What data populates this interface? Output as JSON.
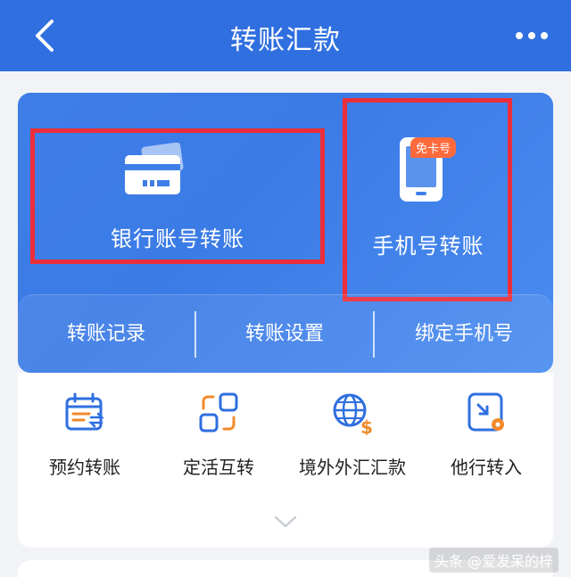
{
  "header": {
    "title": "转账汇款",
    "back_icon": "chevron-left-icon",
    "more_icon": "more-dots-icon"
  },
  "transfer_options": {
    "bank": {
      "label": "银行账号转账",
      "icon": "bank-card-icon"
    },
    "phone": {
      "label": "手机号转账",
      "badge": "免卡号",
      "icon": "mobile-phone-icon"
    }
  },
  "quick_actions": [
    {
      "label": "转账记录"
    },
    {
      "label": "转账设置"
    },
    {
      "label": "绑定手机号"
    }
  ],
  "functions": [
    {
      "label": "预约转账",
      "icon": "calendar-transfer-icon"
    },
    {
      "label": "定活互转",
      "icon": "swap-squares-icon"
    },
    {
      "label": "境外外汇汇款",
      "icon": "globe-dollar-icon"
    },
    {
      "label": "他行转入",
      "icon": "inbound-transfer-icon"
    }
  ],
  "watermark": "头条 @爱发呆的梓",
  "colors": {
    "header": "#2f6fe0",
    "card": "#3f7ee8",
    "highlight": "#ec2e3a",
    "badge": "#ff6a3d",
    "icon_blue": "#2f6fe0",
    "icon_orange": "#f08a2b"
  }
}
